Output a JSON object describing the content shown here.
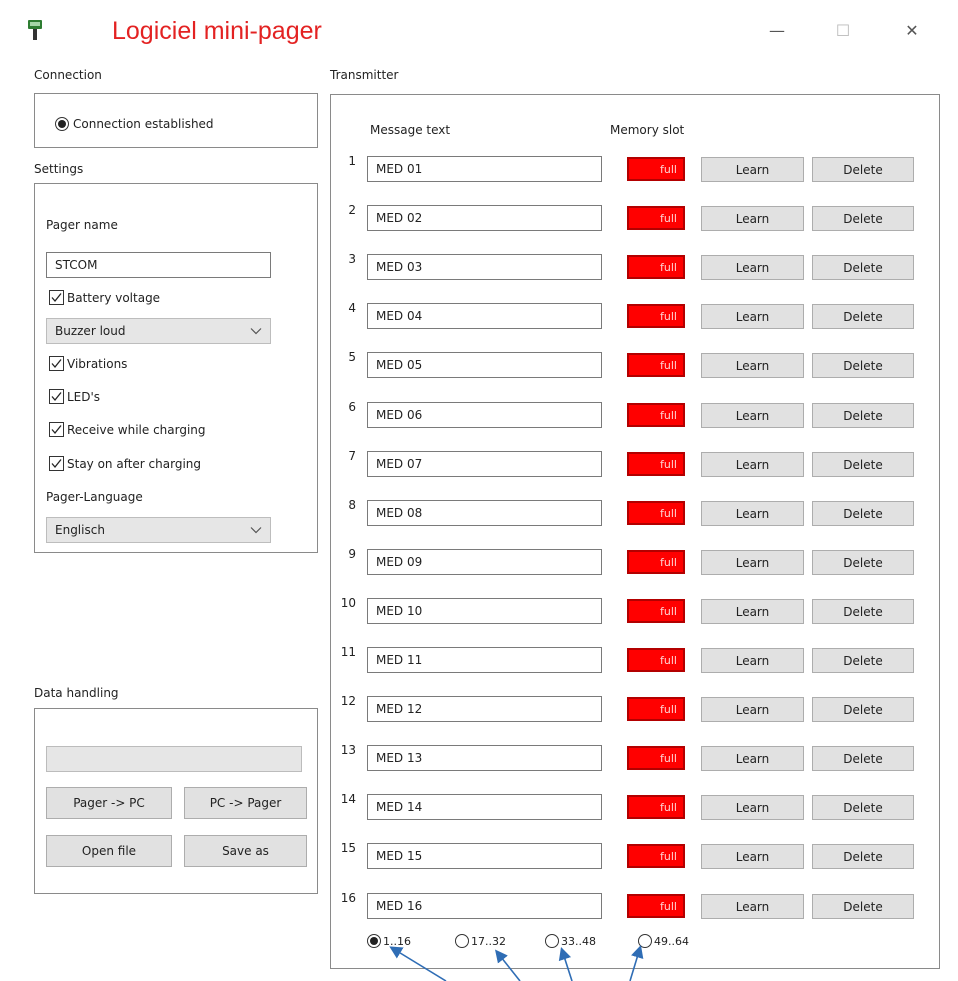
{
  "window": {
    "title": "Logiciel mini-pager",
    "minimize_glyph": "—",
    "maximize_glyph": "☐",
    "close_glyph": "✕"
  },
  "connection": {
    "label": "Connection",
    "status": "Connection established",
    "selected": true
  },
  "settings": {
    "label": "Settings",
    "pager_name_label": "Pager name",
    "pager_name_value": "STCOM",
    "battery_voltage": {
      "label": "Battery voltage",
      "checked": true
    },
    "buzzer": {
      "value": "Buzzer loud"
    },
    "vibrations": {
      "label": "Vibrations",
      "checked": true
    },
    "leds": {
      "label": "LED's",
      "checked": true
    },
    "receive_while_charging": {
      "label": "Receive while charging",
      "checked": true
    },
    "stay_on": {
      "label": "Stay on after charging",
      "checked": true
    },
    "language_label": "Pager-Language",
    "language_value": "Englisch"
  },
  "data_handling": {
    "label": "Data handling",
    "pager_to_pc": "Pager -> PC",
    "pc_to_pager": "PC -> Pager",
    "open_file": "Open file",
    "save_as": "Save as"
  },
  "transmitter": {
    "label": "Transmitter",
    "col_message": "Message text",
    "col_slot": "Memory slot",
    "learn_label": "Learn",
    "delete_label": "Delete",
    "slot_label": "full",
    "slot_color": "#ff0000",
    "rows": [
      {
        "num": "1",
        "text": "MED 01"
      },
      {
        "num": "2",
        "text": "MED 02"
      },
      {
        "num": "3",
        "text": "MED 03"
      },
      {
        "num": "4",
        "text": "MED 04"
      },
      {
        "num": "5",
        "text": "MED 05"
      },
      {
        "num": "6",
        "text": "MED 06"
      },
      {
        "num": "7",
        "text": "MED 07"
      },
      {
        "num": "8",
        "text": "MED 08"
      },
      {
        "num": "9",
        "text": "MED 09"
      },
      {
        "num": "10",
        "text": "MED 10"
      },
      {
        "num": "11",
        "text": "MED 11"
      },
      {
        "num": "12",
        "text": "MED 12"
      },
      {
        "num": "13",
        "text": "MED 13"
      },
      {
        "num": "14",
        "text": "MED 14"
      },
      {
        "num": "15",
        "text": "MED 15"
      },
      {
        "num": "16",
        "text": "MED 16"
      }
    ],
    "pages": [
      {
        "label": "1..16",
        "selected": true
      },
      {
        "label": "17..32",
        "selected": false
      },
      {
        "label": "33..48",
        "selected": false
      },
      {
        "label": "49..64",
        "selected": false
      }
    ]
  },
  "annotation_arrow_color": "#2f6db5"
}
